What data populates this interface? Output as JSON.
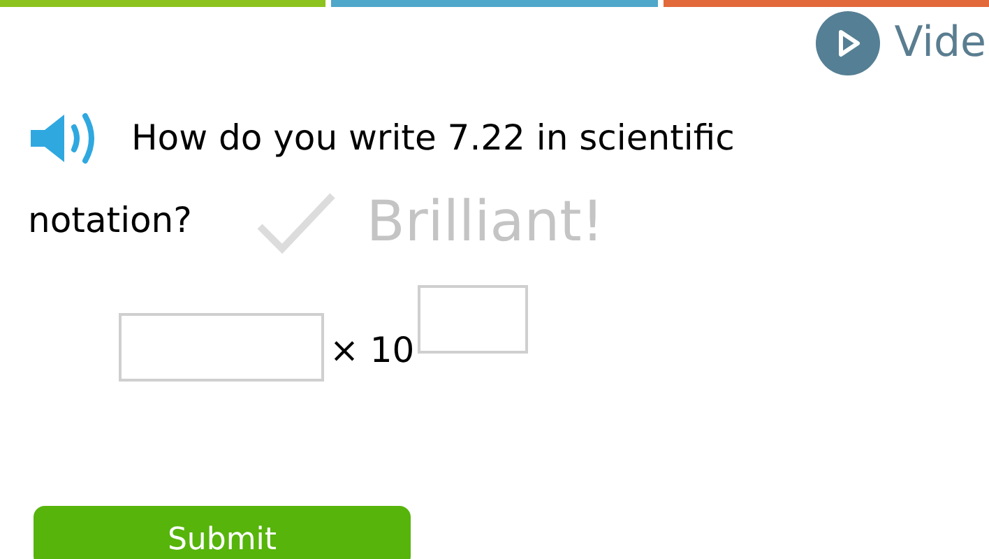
{
  "progress_segments": [
    {
      "color": "#8cc31e"
    },
    {
      "color": "#4fa7c9"
    },
    {
      "color": "#e2693a"
    }
  ],
  "video_button": {
    "label": "Vide"
  },
  "question": {
    "lines": [
      "How do you write 7.22 in scientific",
      "notation?"
    ]
  },
  "feedback": {
    "text": "Brilliant!"
  },
  "answer": {
    "times": "× 10"
  },
  "submit_button": {
    "label": "Submit"
  }
}
